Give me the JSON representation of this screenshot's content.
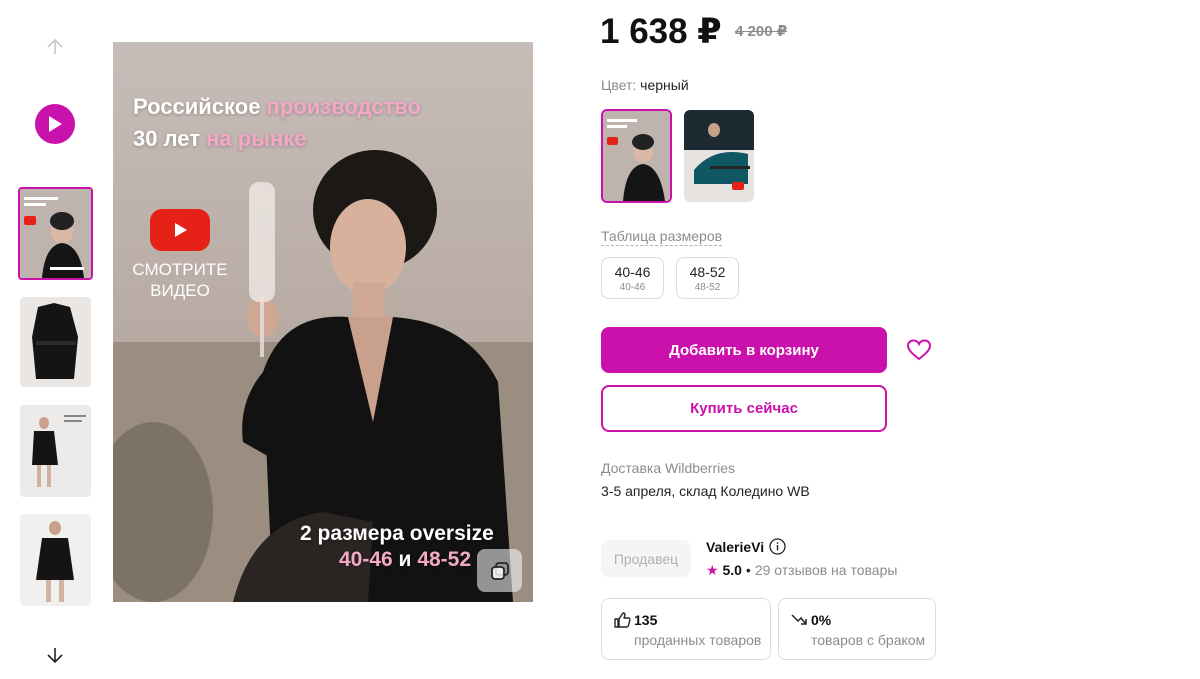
{
  "gallery": {
    "up_icon": "arrow-up-icon",
    "down_icon": "arrow-down-icon",
    "play_icon": "play-icon",
    "copy_icon": "copy-icon",
    "overlay": {
      "line1_white": "Российское ",
      "line1_pink": "производство",
      "line2_white": "30 лет ",
      "line2_pink": "на рынке",
      "watch_video": "СМОТРИТЕ ВИДЕО",
      "sizes_line1": "2 размера oversize",
      "size_a": "40-46",
      "size_and": " и ",
      "size_b": "48-52"
    }
  },
  "product": {
    "price": "1 638 ₽",
    "old_price": "4 200 ₽",
    "color_label": "Цвет:",
    "color_value": "черный",
    "size_table_link": "Таблица размеров",
    "sizes": [
      {
        "label": "40-46",
        "sub": "40-46"
      },
      {
        "label": "48-52",
        "sub": "48-52"
      }
    ],
    "add_to_cart": "Добавить в корзину",
    "buy_now": "Купить сейчас",
    "delivery_label": "Доставка Wildberries",
    "delivery_value": "3-5 апреля, склад Коледино WB"
  },
  "seller": {
    "badge": "Продавец",
    "name": "ValerieVi",
    "star": "★",
    "rating": "5.0",
    "separator": "•",
    "reviews": "29 отзывов на товары"
  },
  "stats": [
    {
      "icon": "thumbs-up-icon",
      "value": "135",
      "label": "проданных товаров"
    },
    {
      "icon": "trend-down-icon",
      "value": "0%",
      "label": "товаров с браком"
    }
  ],
  "colors": {
    "accent": "#cb11ab",
    "youtube_red": "#e62117",
    "muted_text": "#8c8c8c"
  }
}
